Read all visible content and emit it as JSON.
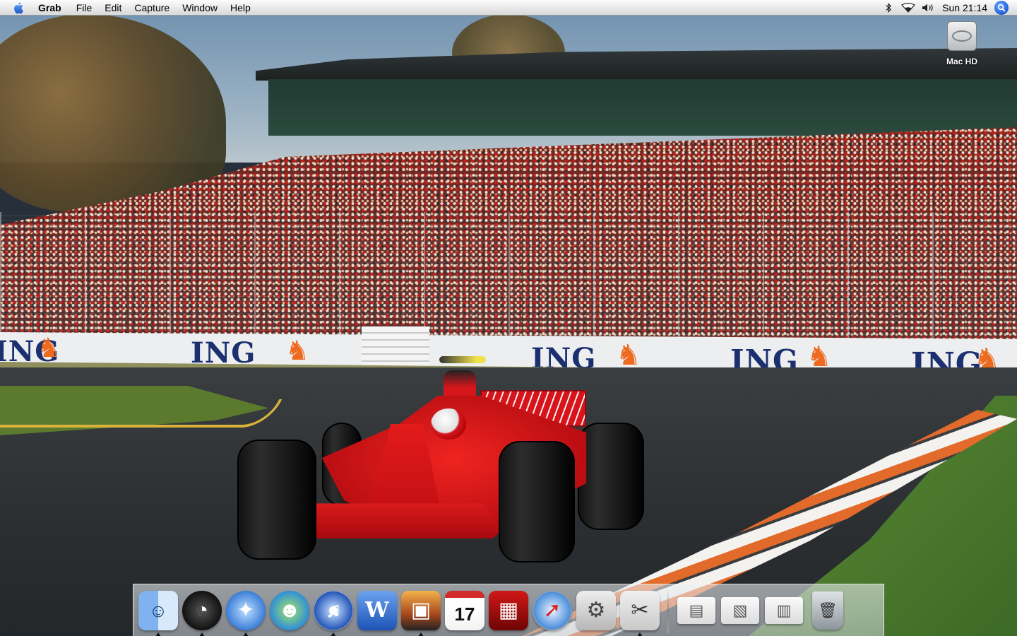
{
  "menubar": {
    "apple_icon": "apple-logo-icon",
    "app_name": "Grab",
    "menus": [
      "File",
      "Edit",
      "Capture",
      "Window",
      "Help"
    ],
    "status_icons": [
      "bluetooth-icon",
      "wifi-icon",
      "volume-icon"
    ],
    "clock": "Sun 21:14",
    "spotlight_icon": "spotlight-search-icon"
  },
  "desktop": {
    "hd_label": "Mac HD"
  },
  "wallpaper": {
    "banner_text": "ING"
  },
  "dock": {
    "apps": [
      {
        "name": "finder",
        "icon": "finder-icon",
        "glyph": "☺",
        "running": true
      },
      {
        "name": "dashboard",
        "icon": "dashboard-icon",
        "glyph": "◔",
        "running": true
      },
      {
        "name": "network-browser",
        "icon": "compass-icon",
        "glyph": "✦",
        "running": true
      },
      {
        "name": "messenger",
        "icon": "messenger-icon",
        "glyph": "☻",
        "running": false
      },
      {
        "name": "itunes",
        "icon": "itunes-icon",
        "glyph": "♫",
        "running": true
      },
      {
        "name": "word",
        "icon": "word-icon",
        "glyph": "W",
        "running": false
      },
      {
        "name": "iphoto",
        "icon": "iphoto-icon",
        "glyph": "▣",
        "running": true
      },
      {
        "name": "ical",
        "icon": "calendar-icon",
        "glyph": "17",
        "running": false
      },
      {
        "name": "photo-booth",
        "icon": "photo-booth-icon",
        "glyph": "▦",
        "running": false
      },
      {
        "name": "safari",
        "icon": "safari-icon",
        "glyph": "➚",
        "running": false
      },
      {
        "name": "system-preferences",
        "icon": "system-preferences-icon",
        "glyph": "⚙",
        "running": false
      },
      {
        "name": "grab",
        "icon": "grab-scissors-icon",
        "glyph": "✂",
        "running": true
      }
    ],
    "documents": [
      {
        "name": "minimized-window-1",
        "icon": "document-thumbnail-icon",
        "glyph": "▤"
      },
      {
        "name": "minimized-window-2",
        "icon": "document-thumbnail-icon",
        "glyph": "▧"
      },
      {
        "name": "minimized-window-3",
        "icon": "document-thumbnail-icon",
        "glyph": "▥"
      }
    ],
    "trash": {
      "icon": "trash-icon",
      "glyph": "🗑"
    }
  }
}
